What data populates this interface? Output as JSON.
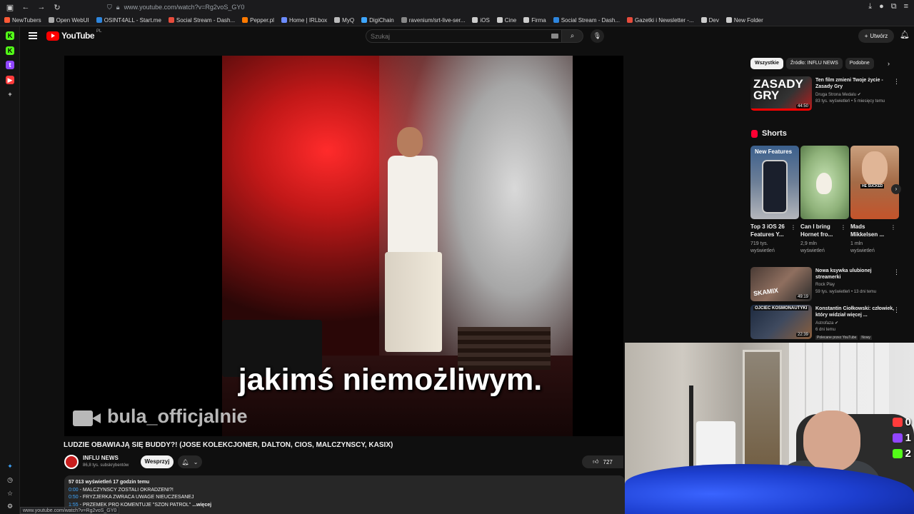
{
  "browser": {
    "url_display": "www.youtube.com/watch?v=Rg2voS_GY0",
    "status_url": "www.youtube.com/watch?v=Rg2voS_GY0",
    "bookmarks": [
      "NewTubers",
      "Open WebUI",
      "OSINT4ALL - Start.me",
      "Social Stream - Dash...",
      "Pepper.pl",
      "Home | IRLbox",
      "MyQ",
      "DigiChain",
      "ravenium/srt-live-ser...",
      "iOS",
      "Cine",
      "Firma",
      "Social Stream - Dash...",
      "Gazetki i Newsletter -...",
      "Dev",
      "New Folder"
    ]
  },
  "header": {
    "logo_text": "YouTube",
    "logo_country": "PL",
    "search_placeholder": "Szukaj",
    "create_label": "Utwórz"
  },
  "video": {
    "subtitle": "jakimś niemożliwym.",
    "watermark": "bula_officjalnie",
    "title": "LUDZIE OBAWIAJĄ SIĘ BUDDY?! (JOSE KOLEKCJONER, DALTON, CIOS, MALCZYNSCY, KASIX)",
    "channel": "INFLU NEWS",
    "subscribers": "86,8 tys. subskrybentów",
    "support_label": "Wesprzyj",
    "likes": "727"
  },
  "description": {
    "meta": "57 013 wyświetleń  17 godzin temu",
    "lines": [
      {
        "ts": "0:00",
        "text": "- MALCZYNSCY ZOSTALI OKRADZENI?!"
      },
      {
        "ts": "0:50",
        "text": "- FRYZJERKA ZWRACA UWAGE NIEUCZESANEJ"
      },
      {
        "ts": "1:55",
        "text": "- PRZEMEK PRO KOMENTUJE \"SZON PATROL\""
      }
    ],
    "more_label": "...więcej"
  },
  "sidebar": {
    "chips": [
      "Wszystkie",
      "Źródło: INFLU NEWS",
      "Podobne"
    ],
    "top_rec": {
      "title": "Ten film zmieni Twoje życie - Zasady Gry",
      "channel": "Druga Strona Medalu",
      "meta": "83 tys. wyświetleń • 5 miesięcy temu",
      "duration": "44:50",
      "thumb_text": "ZASADY GRY"
    },
    "shorts_label": "Shorts",
    "shorts": [
      {
        "title": "Top 3 iOS 26 Features Y...",
        "views1": "719 tys.",
        "views2": "wyświetleń",
        "thumb": "New Features"
      },
      {
        "title": "Can I bring Hornet fro...",
        "views1": "2,9 mln",
        "views2": "wyświetleń",
        "thumb": ""
      },
      {
        "title": "Mads Mikkelsen ...",
        "views1": "1 mln",
        "views2": "wyświetleń",
        "thumb": "HE SUCKED"
      }
    ],
    "recs": [
      {
        "title": "Nowa ksywka ulubionej streamerki",
        "channel": "Rock Play",
        "meta": "59 tys. wyświetleń • 13 dni temu",
        "duration": "49:19",
        "thumb_text": "SKAMIX"
      },
      {
        "title": "Konstantin Ciołkowski: człowiek, który widział więcej ...",
        "channel": "Astrofaza",
        "meta": "6 dni temu",
        "duration": "22:39",
        "thumb_text": "OJCIEC KOSMONAUTYKI",
        "badge1": "Polecane przez YouTube",
        "badge2": "Nowy"
      }
    ]
  },
  "overlay": {
    "counters": [
      {
        "platform": "youtube-icon",
        "value": "0",
        "color": "#ff3b3b"
      },
      {
        "platform": "twitch-icon",
        "value": "1",
        "color": "#9146ff"
      },
      {
        "platform": "kick-icon",
        "value": "2",
        "color": "#53fc18"
      }
    ]
  }
}
